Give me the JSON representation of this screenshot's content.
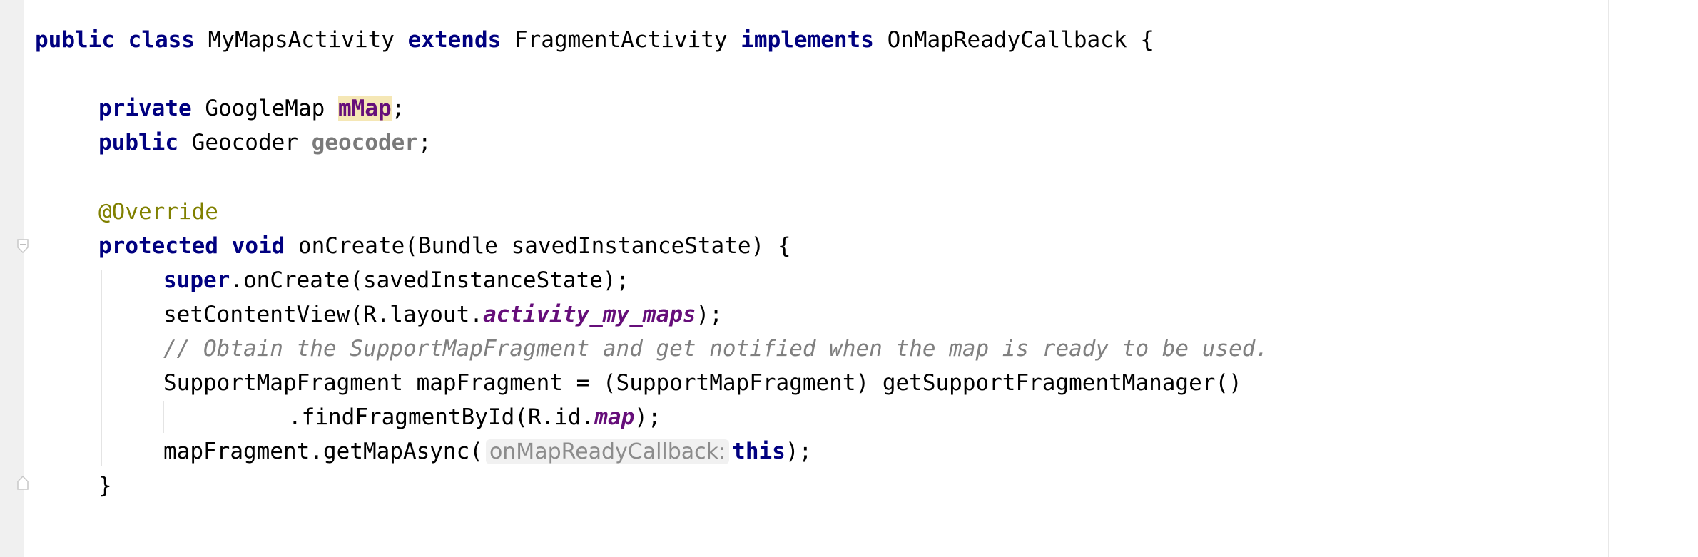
{
  "editor": {
    "lines": {
      "l1": {
        "kw1": "public",
        "kw2": "class",
        "name": "MyMapsActivity",
        "kw3": "extends",
        "parent": "FragmentActivity",
        "kw4": "implements",
        "iface": "OnMapReadyCallback",
        "brace": "{"
      },
      "l3": {
        "kw": "private",
        "type": "GoogleMap",
        "field": "mMap",
        "semi": ";"
      },
      "l4": {
        "kw": "public",
        "type": "Geocoder",
        "field": "geocoder",
        "semi": ";"
      },
      "l6": {
        "annotation": "@Override"
      },
      "l7": {
        "kw1": "protected",
        "kw2": "void",
        "rest": "onCreate(Bundle savedInstanceState) {"
      },
      "l8": {
        "kw": "super",
        "rest": ".onCreate(savedInstanceState);"
      },
      "l9": {
        "pre": "setContentView(R.layout.",
        "field": "activity_my_maps",
        "post": ");"
      },
      "l10": {
        "comment": "// Obtain the SupportMapFragment and get notified when the map is ready to be used."
      },
      "l11": {
        "text": "SupportMapFragment mapFragment = (SupportMapFragment) getSupportFragmentManager()"
      },
      "l12": {
        "pre": ".findFragmentById(R.id.",
        "field": "map",
        "post": ");"
      },
      "l13": {
        "pre": "mapFragment.getMapAsync(",
        "hint": "onMapReadyCallback:",
        "kw": "this",
        "post": ");"
      },
      "l14": {
        "brace": "}"
      }
    }
  }
}
